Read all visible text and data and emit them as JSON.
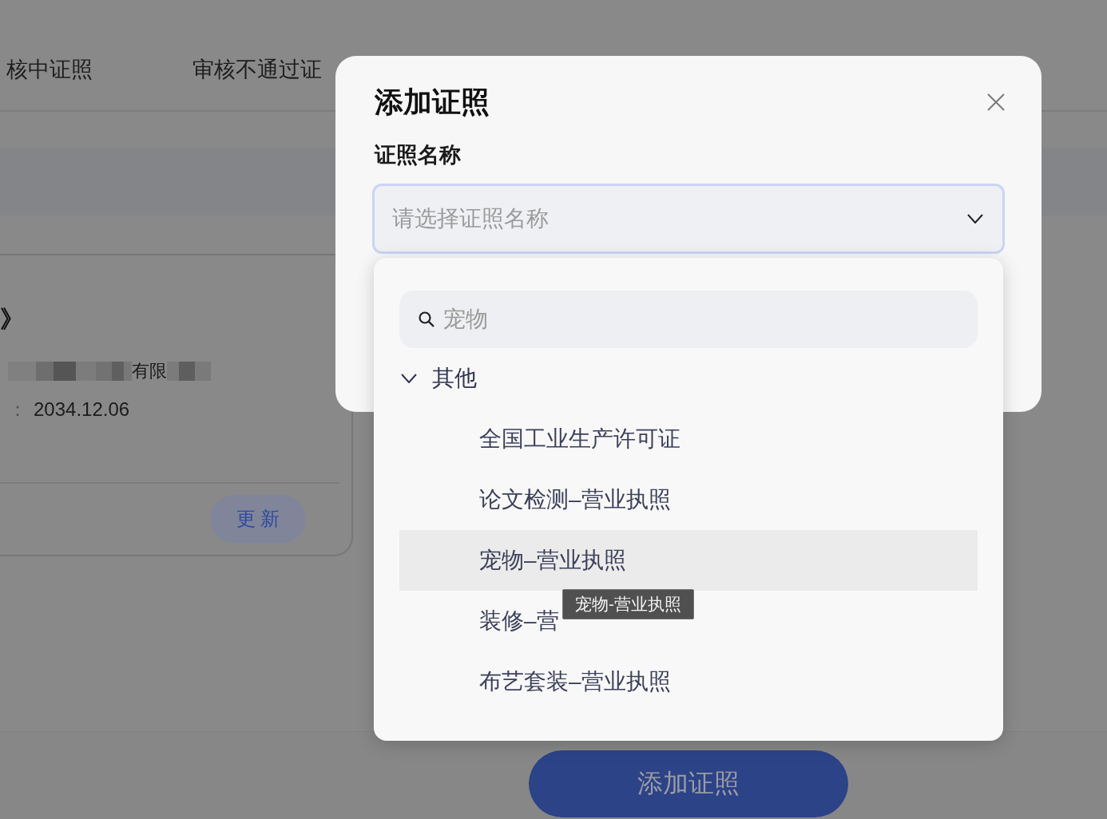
{
  "background_page": {
    "tabs": [
      {
        "label": "核中证照",
        "selected": false
      },
      {
        "label": "审核不通过证",
        "selected": false
      }
    ],
    "license_card": {
      "title": "》",
      "holder_visible_text": "有限",
      "expiry_label": "：",
      "expiry_date": "2034.12.06",
      "update_button": "更 新"
    },
    "add_button": "添加证照"
  },
  "dialog": {
    "title": "添加证照",
    "field_label": "证照名称",
    "select": {
      "placeholder": "请选择证照名称",
      "open": true
    },
    "dropdown": {
      "search": {
        "placeholder": "宠物"
      },
      "groups": [
        {
          "label": "其他",
          "expanded": true,
          "children": [
            {
              "label": "全国工业生产许可证",
              "highlighted": false
            },
            {
              "label": "论文检测–营业执照",
              "highlighted": false
            },
            {
              "label": "宠物–营业执照",
              "highlighted": true
            },
            {
              "label": "装修–营",
              "highlighted": false
            },
            {
              "label": "布艺套装–营业执照",
              "highlighted": false
            }
          ]
        }
      ]
    },
    "tooltip": {
      "text": "宠物-营业执照"
    }
  }
}
